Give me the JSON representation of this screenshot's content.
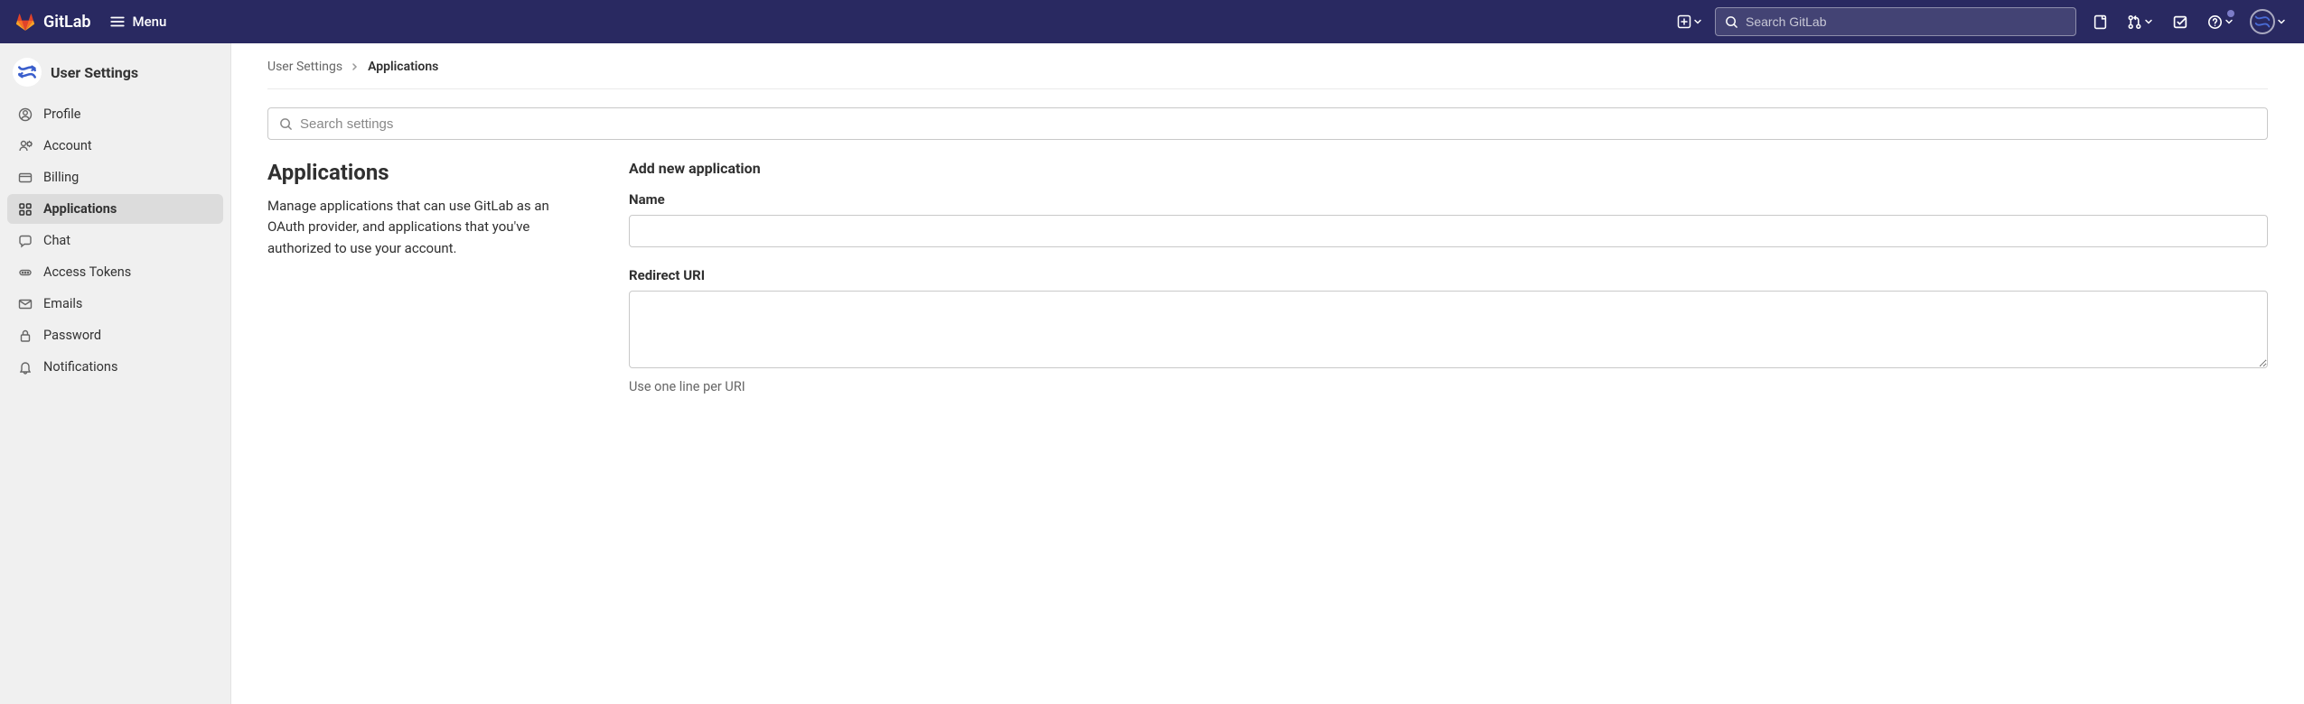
{
  "navbar": {
    "brand": "GitLab",
    "menu_label": "Menu",
    "search_placeholder": "Search GitLab"
  },
  "sidebar": {
    "title": "User Settings",
    "items": [
      {
        "label": "Profile",
        "icon": "profile-icon",
        "active": false
      },
      {
        "label": "Account",
        "icon": "account-icon",
        "active": false
      },
      {
        "label": "Billing",
        "icon": "billing-icon",
        "active": false
      },
      {
        "label": "Applications",
        "icon": "apps-icon",
        "active": true
      },
      {
        "label": "Chat",
        "icon": "chat-icon",
        "active": false
      },
      {
        "label": "Access Tokens",
        "icon": "token-icon",
        "active": false
      },
      {
        "label": "Emails",
        "icon": "mail-icon",
        "active": false
      },
      {
        "label": "Password",
        "icon": "lock-icon",
        "active": false
      },
      {
        "label": "Notifications",
        "icon": "bell-icon",
        "active": false
      }
    ]
  },
  "breadcrumb": {
    "items": [
      {
        "label": "User Settings",
        "current": false
      },
      {
        "label": "Applications",
        "current": true
      }
    ]
  },
  "settings_search": {
    "placeholder": "Search settings"
  },
  "page": {
    "title": "Applications",
    "description": "Manage applications that can use GitLab as an OAuth provider, and applications that you've authorized to use your account."
  },
  "form": {
    "section_title": "Add new application",
    "name_label": "Name",
    "redirect_label": "Redirect URI",
    "redirect_help": "Use one line per URI"
  }
}
